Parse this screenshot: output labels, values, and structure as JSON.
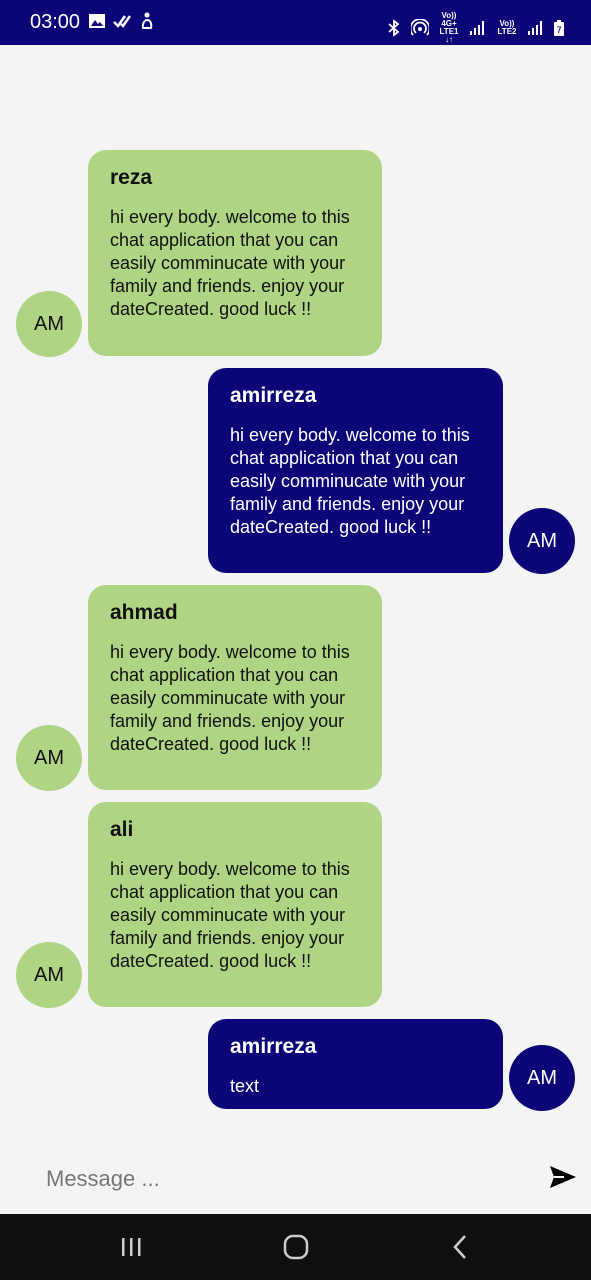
{
  "status_bar": {
    "time": "03:00",
    "sim1_top": "Vo)) 4G+",
    "sim1_bottom": "LTE1 ↓↑",
    "sim2_top": "Vo))",
    "sim2_bottom": "LTE2",
    "battery_level": "7"
  },
  "messages": [
    {
      "sender": "reza",
      "text": "hi every body. welcome to this chat application that you can easily comminucate with your family and friends. enjoy your dateCreated. good luck !!",
      "avatar": "AM",
      "side": "other"
    },
    {
      "sender": "amirreza",
      "text": "hi every body. welcome to this chat application that you can easily comminucate with your family and friends. enjoy your dateCreated. good luck !!",
      "avatar": "AM",
      "side": "me"
    },
    {
      "sender": "ahmad",
      "text": "hi every body. welcome to this chat application that you can easily comminucate with your family and friends. enjoy your dateCreated. good luck !!",
      "avatar": "AM",
      "side": "other"
    },
    {
      "sender": "ali",
      "text": "hi every body. welcome to this chat application that you can easily comminucate with your family and friends. enjoy your dateCreated. good luck !!",
      "avatar": "AM",
      "side": "other"
    },
    {
      "sender": "amirreza",
      "text": "text",
      "avatar": "AM",
      "side": "me"
    }
  ],
  "composer": {
    "placeholder": "Message ...",
    "send_icon": "send-icon"
  },
  "colors": {
    "primary": "#0b0578",
    "other_bubble": "#afd484",
    "background": "#f4f4f4"
  }
}
